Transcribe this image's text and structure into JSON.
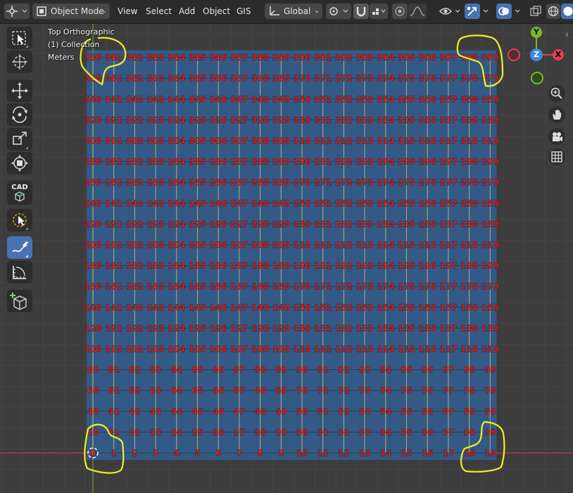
{
  "header": {
    "mode_label": "Object Mode",
    "menus": [
      "View",
      "Select",
      "Add",
      "Object",
      "GIS"
    ],
    "orientation_label": "Global"
  },
  "overlay": {
    "view_name": "Top Orthographic",
    "collection": "(1) Collection",
    "units": "Meters"
  },
  "tools": [
    {
      "name": "select-box-icon",
      "active": false
    },
    {
      "name": "cursor-icon",
      "active": false
    },
    {
      "name": "move-icon",
      "active": false
    },
    {
      "name": "rotate-icon",
      "active": false
    },
    {
      "name": "scale-icon",
      "active": false
    },
    {
      "name": "transform-icon",
      "active": false
    },
    {
      "name": "cad-transform-icon",
      "label": "CAD",
      "active": false
    },
    {
      "name": "select-lasso-icon",
      "active": false
    },
    {
      "name": "annotate-icon",
      "active": true
    },
    {
      "name": "measure-icon",
      "active": false
    },
    {
      "name": "add-cube-icon",
      "active": false
    }
  ],
  "gizmo": {
    "axes": [
      "X",
      "Y",
      "Z"
    ]
  },
  "nav_buttons": [
    "zoom-icon",
    "pan-hand-icon",
    "camera-icon",
    "grid-toggle-icon"
  ],
  "grid": {
    "rows": 20,
    "columns": 20,
    "start_index": 0,
    "label_color": "#e02020",
    "plane_color": "#335a86"
  },
  "colors": {
    "accent": "#4772b3",
    "x_axis": "#e04050",
    "y_axis": "#7ab82a",
    "z_axis": "#3d89e0",
    "annotation": "#f0f020"
  }
}
